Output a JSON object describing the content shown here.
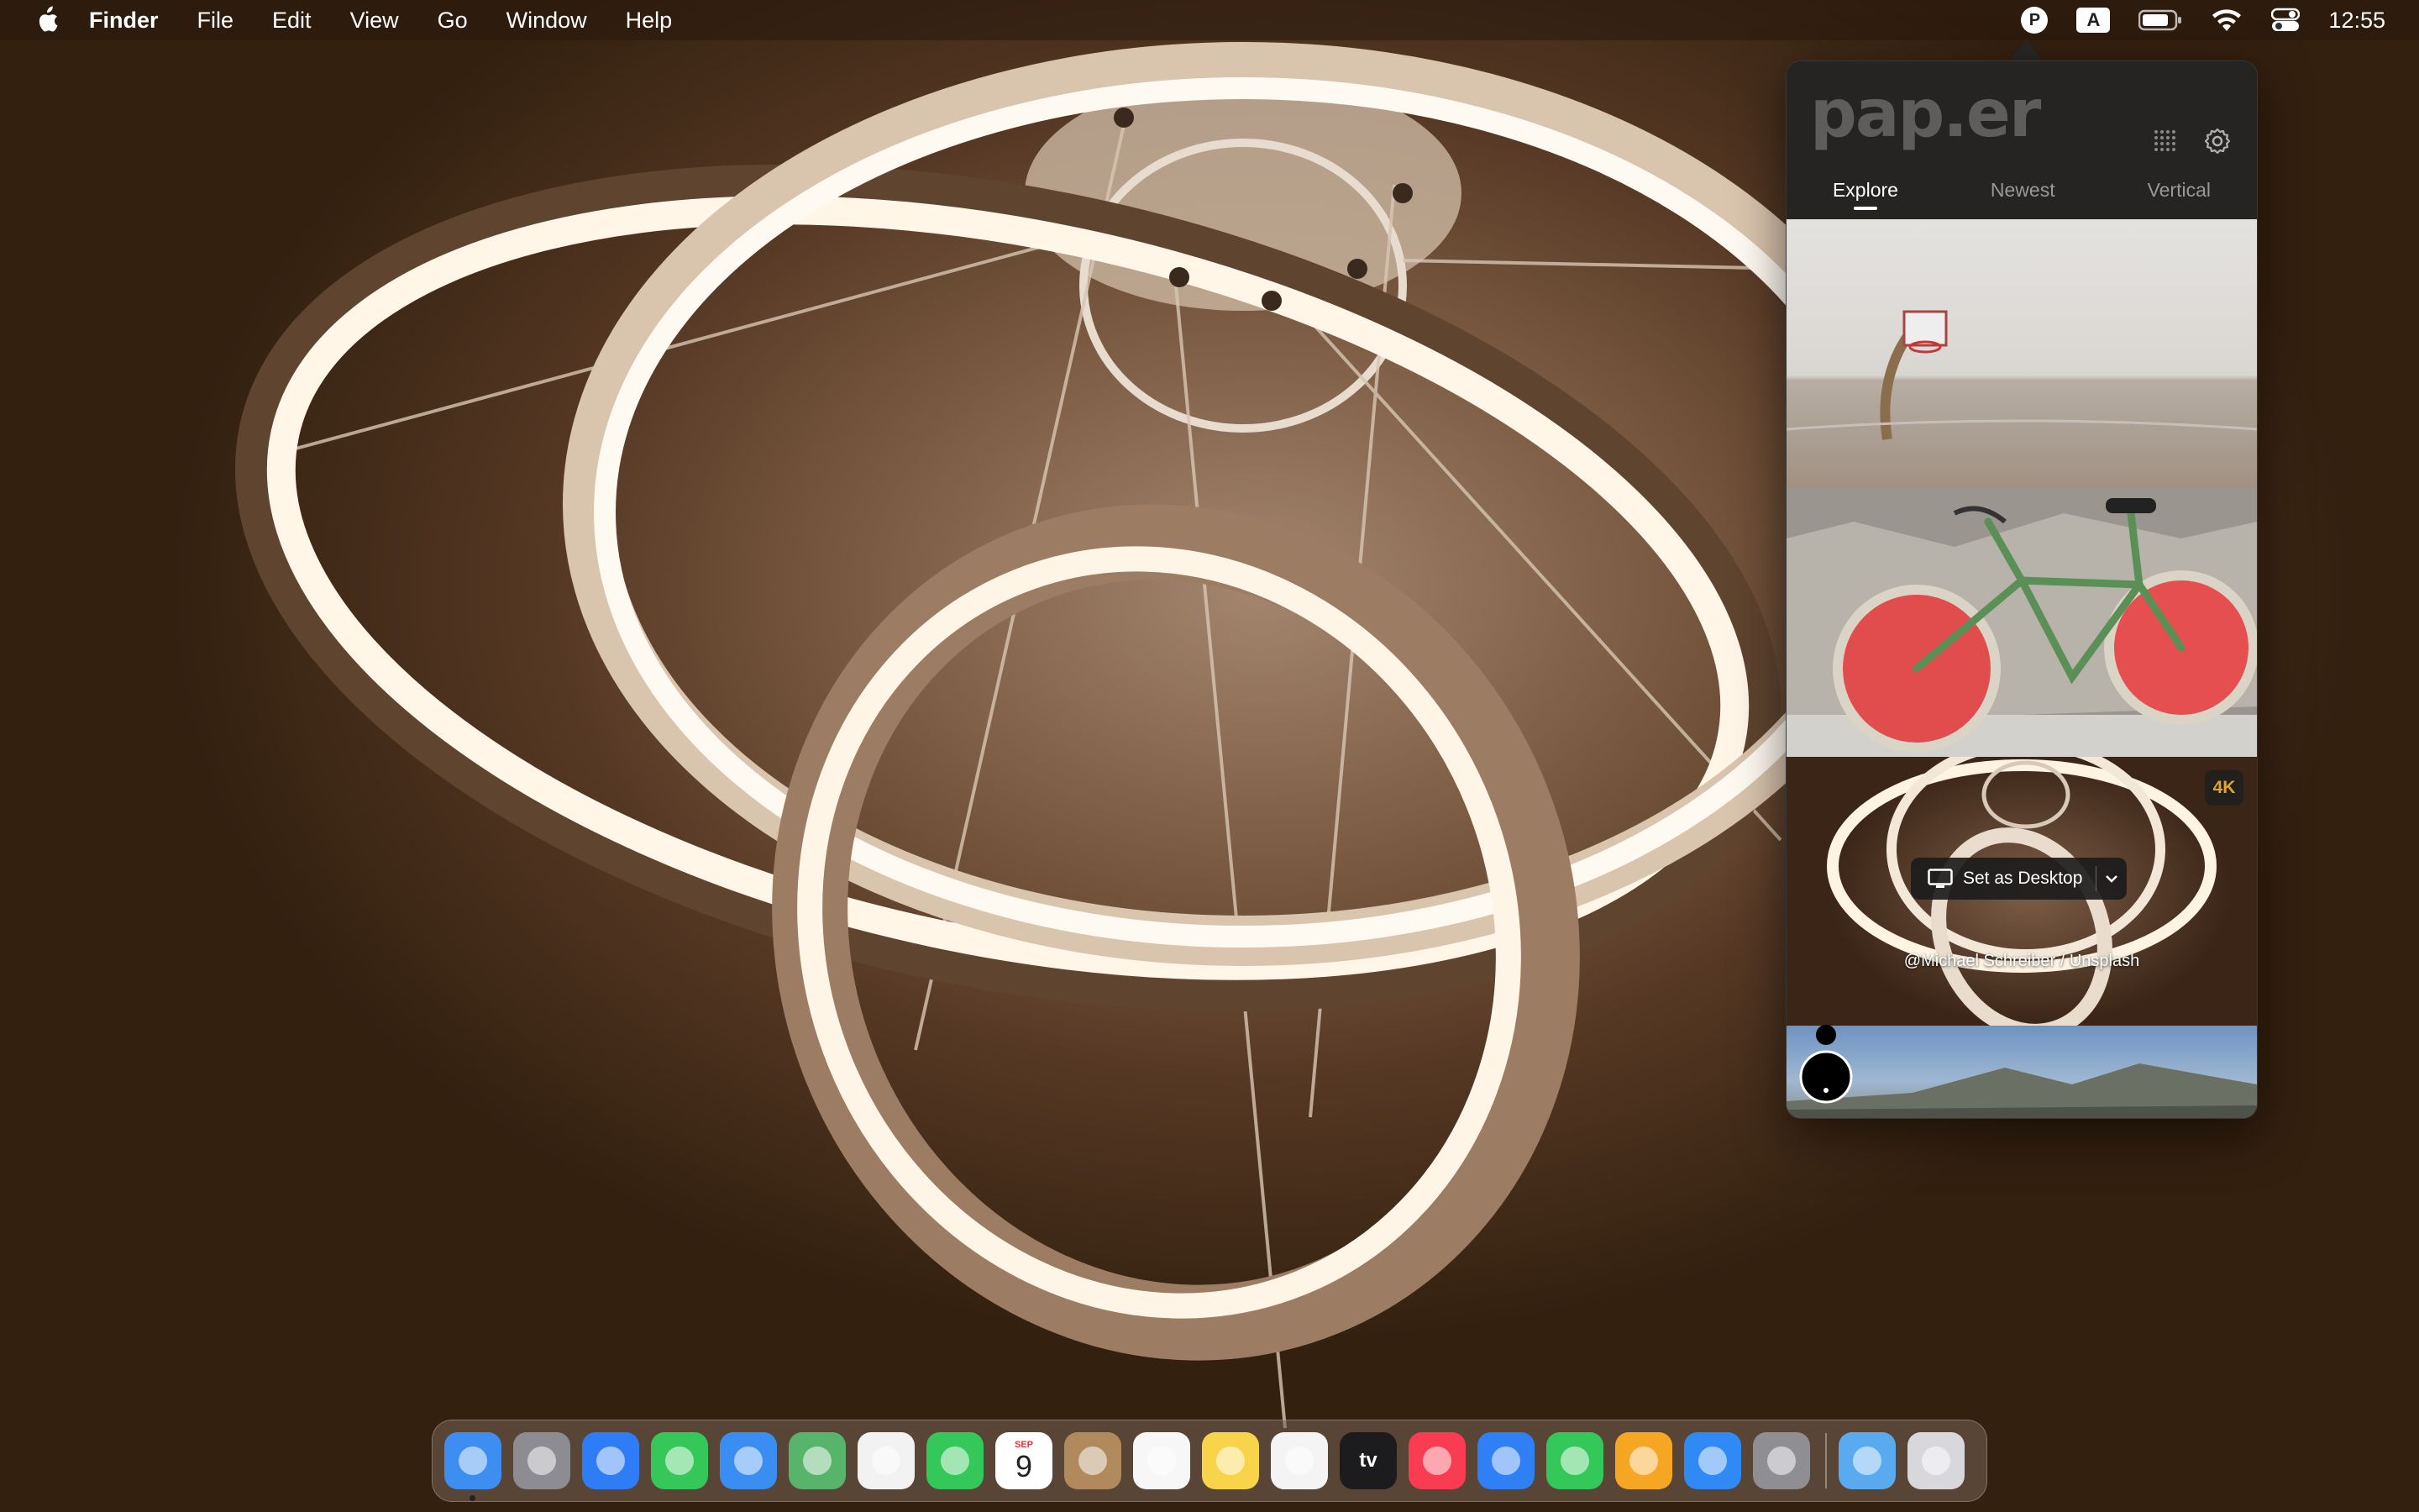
{
  "menubar": {
    "app_name": "Finder",
    "menus": [
      "File",
      "Edit",
      "View",
      "Go",
      "Window",
      "Help"
    ],
    "status_icons": [
      "paper-app-icon",
      "input-source-icon",
      "battery-icon",
      "wifi-icon",
      "control-center-icon"
    ],
    "input_source_letter": "A",
    "paper_letter": "P",
    "clock": "12:55"
  },
  "popover": {
    "logo": "pap.er",
    "tabs": [
      {
        "label": "Explore",
        "active": true
      },
      {
        "label": "Newest",
        "active": false
      },
      {
        "label": "Vertical",
        "active": false
      }
    ],
    "thumbnails": [
      {
        "name": "basketball-hoop-photo"
      },
      {
        "name": "watermelon-bicycle-photo"
      },
      {
        "name": "ring-chandelier-photo",
        "badge": "4K",
        "action": "Set as Desktop",
        "credit": "@Michael Schreiber / Unsplash"
      },
      {
        "name": "mountain-landscape-photo"
      }
    ]
  },
  "dock": {
    "apps": [
      {
        "name": "Finder",
        "color": "#3d8ef0",
        "running": true
      },
      {
        "name": "Launchpad",
        "color": "#8c8c92"
      },
      {
        "name": "Safari",
        "color": "#2e7cf6"
      },
      {
        "name": "Messages",
        "color": "#35c759"
      },
      {
        "name": "Mail",
        "color": "#3a8ef2"
      },
      {
        "name": "Maps",
        "color": "#58b36b"
      },
      {
        "name": "Photos",
        "color": "#f2f2f2"
      },
      {
        "name": "FaceTime",
        "color": "#34c759"
      },
      {
        "name": "Calendar",
        "color": "#ffffff",
        "month": "SEP",
        "day": "9"
      },
      {
        "name": "Contacts",
        "color": "#b08a5c"
      },
      {
        "name": "Reminders",
        "color": "#f7f7f7"
      },
      {
        "name": "Notes",
        "color": "#f8d44b"
      },
      {
        "name": "Freeform",
        "color": "#f4f4f4"
      },
      {
        "name": "TV",
        "color": "#1c1c1e",
        "label": "tv"
      },
      {
        "name": "Music",
        "color": "#fa3c52"
      },
      {
        "name": "Keynote",
        "color": "#2f7ff5"
      },
      {
        "name": "Numbers",
        "color": "#34c759"
      },
      {
        "name": "Pages",
        "color": "#f5a623"
      },
      {
        "name": "App Store",
        "color": "#2f8af5"
      },
      {
        "name": "System Settings",
        "color": "#8e8e93"
      }
    ],
    "trailing": [
      {
        "name": "Downloads",
        "color": "#5aaaf0"
      },
      {
        "name": "Trash",
        "color": "#d8d8dc"
      }
    ]
  }
}
